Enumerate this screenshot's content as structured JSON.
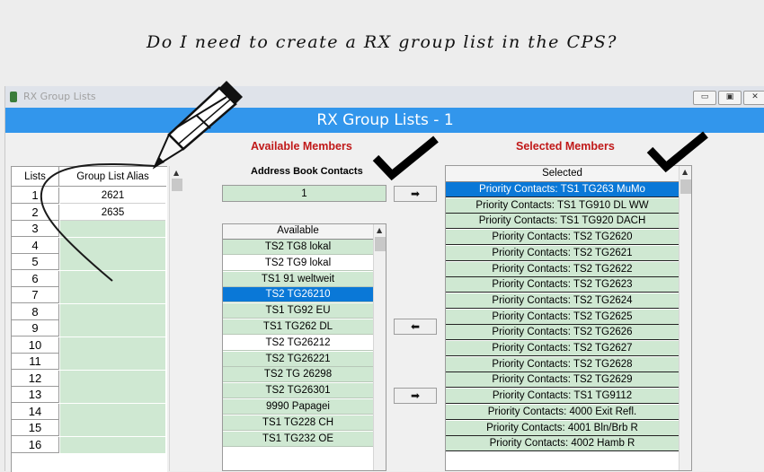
{
  "caption": "Do I need to create a RX group list in the CPS?",
  "window": {
    "title": "RX Group Lists",
    "banner": "RX Group Lists - 1",
    "minimize_glyph": "▭",
    "restore_glyph": "▣",
    "close_glyph": "✕"
  },
  "lists_table": {
    "headers": [
      "Lists",
      "Group List Alias"
    ],
    "rows": [
      {
        "num": "1",
        "alias": "2621"
      },
      {
        "num": "2",
        "alias": "2635"
      },
      {
        "num": "3",
        "alias": ""
      },
      {
        "num": "4",
        "alias": ""
      },
      {
        "num": "5",
        "alias": ""
      },
      {
        "num": "6",
        "alias": ""
      },
      {
        "num": "7",
        "alias": ""
      },
      {
        "num": "8",
        "alias": ""
      },
      {
        "num": "9",
        "alias": ""
      },
      {
        "num": "10",
        "alias": ""
      },
      {
        "num": "11",
        "alias": ""
      },
      {
        "num": "12",
        "alias": ""
      },
      {
        "num": "13",
        "alias": ""
      },
      {
        "num": "14",
        "alias": ""
      },
      {
        "num": "15",
        "alias": ""
      },
      {
        "num": "16",
        "alias": ""
      }
    ]
  },
  "available": {
    "title": "Available Members",
    "address_book_label": "Address Book Contacts",
    "address_book_value": "1",
    "header": "Available",
    "items": [
      {
        "text": "TS2 TG8 lokal",
        "style": "green"
      },
      {
        "text": "TS2 TG9 lokal",
        "style": "white"
      },
      {
        "text": "TS1 91 weltweit",
        "style": "green"
      },
      {
        "text": "TS2 TG26210",
        "style": "blue"
      },
      {
        "text": "TS1 TG92 EU",
        "style": "green"
      },
      {
        "text": "TS1 TG262 DL",
        "style": "green"
      },
      {
        "text": "TS2 TG26212",
        "style": "white"
      },
      {
        "text": "TS2 TG26221",
        "style": "green"
      },
      {
        "text": "TS2 TG 26298",
        "style": "green"
      },
      {
        "text": "TS2 TG26301",
        "style": "green"
      },
      {
        "text": "9990 Papagei",
        "style": "green"
      },
      {
        "text": "TS1 TG228 CH",
        "style": "green"
      },
      {
        "text": "TS1 TG232 OE",
        "style": "green"
      }
    ]
  },
  "selected": {
    "title": "Selected Members",
    "header": "Selected",
    "items": [
      {
        "text": "Priority Contacts: TS1 TG263 MuMo",
        "style": "blue"
      },
      {
        "text": "Priority Contacts: TS1 TG910 DL WW",
        "style": "green"
      },
      {
        "text": "Priority Contacts: TS1 TG920 DACH",
        "style": "green"
      },
      {
        "text": "Priority Contacts: TS2 TG2620",
        "style": "green"
      },
      {
        "text": "Priority Contacts: TS2 TG2621",
        "style": "green"
      },
      {
        "text": "Priority Contacts: TS2 TG2622",
        "style": "green"
      },
      {
        "text": "Priority Contacts: TS2 TG2623",
        "style": "green"
      },
      {
        "text": "Priority Contacts: TS2 TG2624",
        "style": "green"
      },
      {
        "text": "Priority Contacts: TS2 TG2625",
        "style": "green"
      },
      {
        "text": "Priority Contacts: TS2 TG2626",
        "style": "green"
      },
      {
        "text": "Priority Contacts: TS2 TG2627",
        "style": "green"
      },
      {
        "text": "Priority Contacts: TS2 TG2628",
        "style": "green"
      },
      {
        "text": "Priority Contacts: TS2 TG2629",
        "style": "green"
      },
      {
        "text": "Priority Contacts: TS1 TG9112",
        "style": "green"
      },
      {
        "text": "Priority Contacts: 4000 Exit Refl.",
        "style": "green"
      },
      {
        "text": "Priority Contacts: 4001 Bln/Brb R",
        "style": "green"
      },
      {
        "text": "Priority Contacts: 4002 Hamb R",
        "style": "green"
      }
    ]
  },
  "buttons": {
    "add_glyph": "➡",
    "remove_glyph": "⬅"
  },
  "colors": {
    "banner": "#3296ec",
    "row_green": "#cfe8d2",
    "row_selected": "#0a78d7",
    "section_title": "#c01818"
  }
}
